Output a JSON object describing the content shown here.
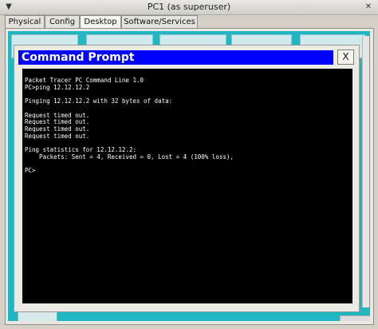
{
  "window": {
    "title": "PC1 (as superuser)"
  },
  "tabs": [
    {
      "label": "Physical"
    },
    {
      "label": "Config"
    },
    {
      "label": "Desktop"
    },
    {
      "label": "Software/Services"
    }
  ],
  "active_tab": "Desktop",
  "command_prompt": {
    "title": "Command Prompt",
    "close_label": "X",
    "output": "Packet Tracer PC Command Line 1.0\nPC>ping 12.12.12.2\n\nPinging 12.12.12.2 with 32 bytes of data:\n\nRequest timed out.\nRequest timed out.\nRequest timed out.\nRequest timed out.\n\nPing statistics for 12.12.12.2:\n    Packets: Sent = 4, Received = 0, Lost = 4 (100% loss),\n\nPC>"
  }
}
